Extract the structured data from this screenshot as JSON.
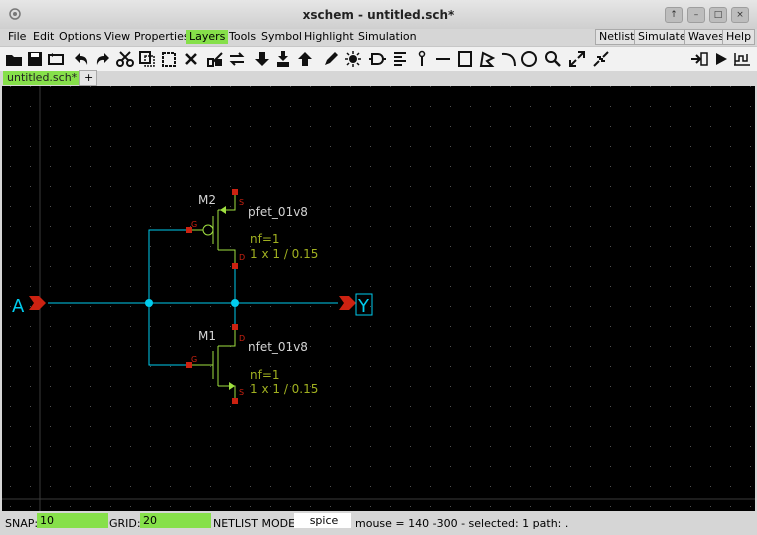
{
  "window": {
    "title": "xschem - untitled.sch*"
  },
  "menu": {
    "file": "File",
    "edit": "Edit",
    "options": "Options",
    "view": "View",
    "properties": "Properties",
    "layers": "Layers",
    "tools": "Tools",
    "symbol": "Symbol",
    "highlight": "Highlight",
    "simulation": "Simulation",
    "netlist": "Netlist",
    "simulate": "Simulate",
    "waves": "Waves",
    "help": "Help"
  },
  "tabs": {
    "active": "untitled.sch*",
    "add": "+"
  },
  "schematic": {
    "input_pin": "A",
    "output_pin": "Y",
    "pmos": {
      "name": "M2",
      "model": "pfet_01v8",
      "nf": "nf=1",
      "size": "1 x 1 / 0.15",
      "pin_g": "G",
      "pin_s": "S",
      "pin_d": "D"
    },
    "nmos": {
      "name": "M1",
      "model": "nfet_01v8",
      "nf": "nf=1",
      "size": "1 x 1 / 0.15",
      "pin_g": "G",
      "pin_s": "S",
      "pin_d": "D"
    }
  },
  "status": {
    "snap_label": "SNAP:",
    "snap_value": "10",
    "grid_label": "GRID:",
    "grid_value": "20",
    "netlist_label": "NETLIST MODE:",
    "netlist_value": "spice",
    "info": "mouse = 140 -300 - selected: 1 path: ."
  },
  "colors": {
    "menu_highlight": "#86e04a",
    "wire": "#00ccee",
    "component": "#a0e040",
    "pin": "#cc2211",
    "text": "#d4d4d4"
  }
}
